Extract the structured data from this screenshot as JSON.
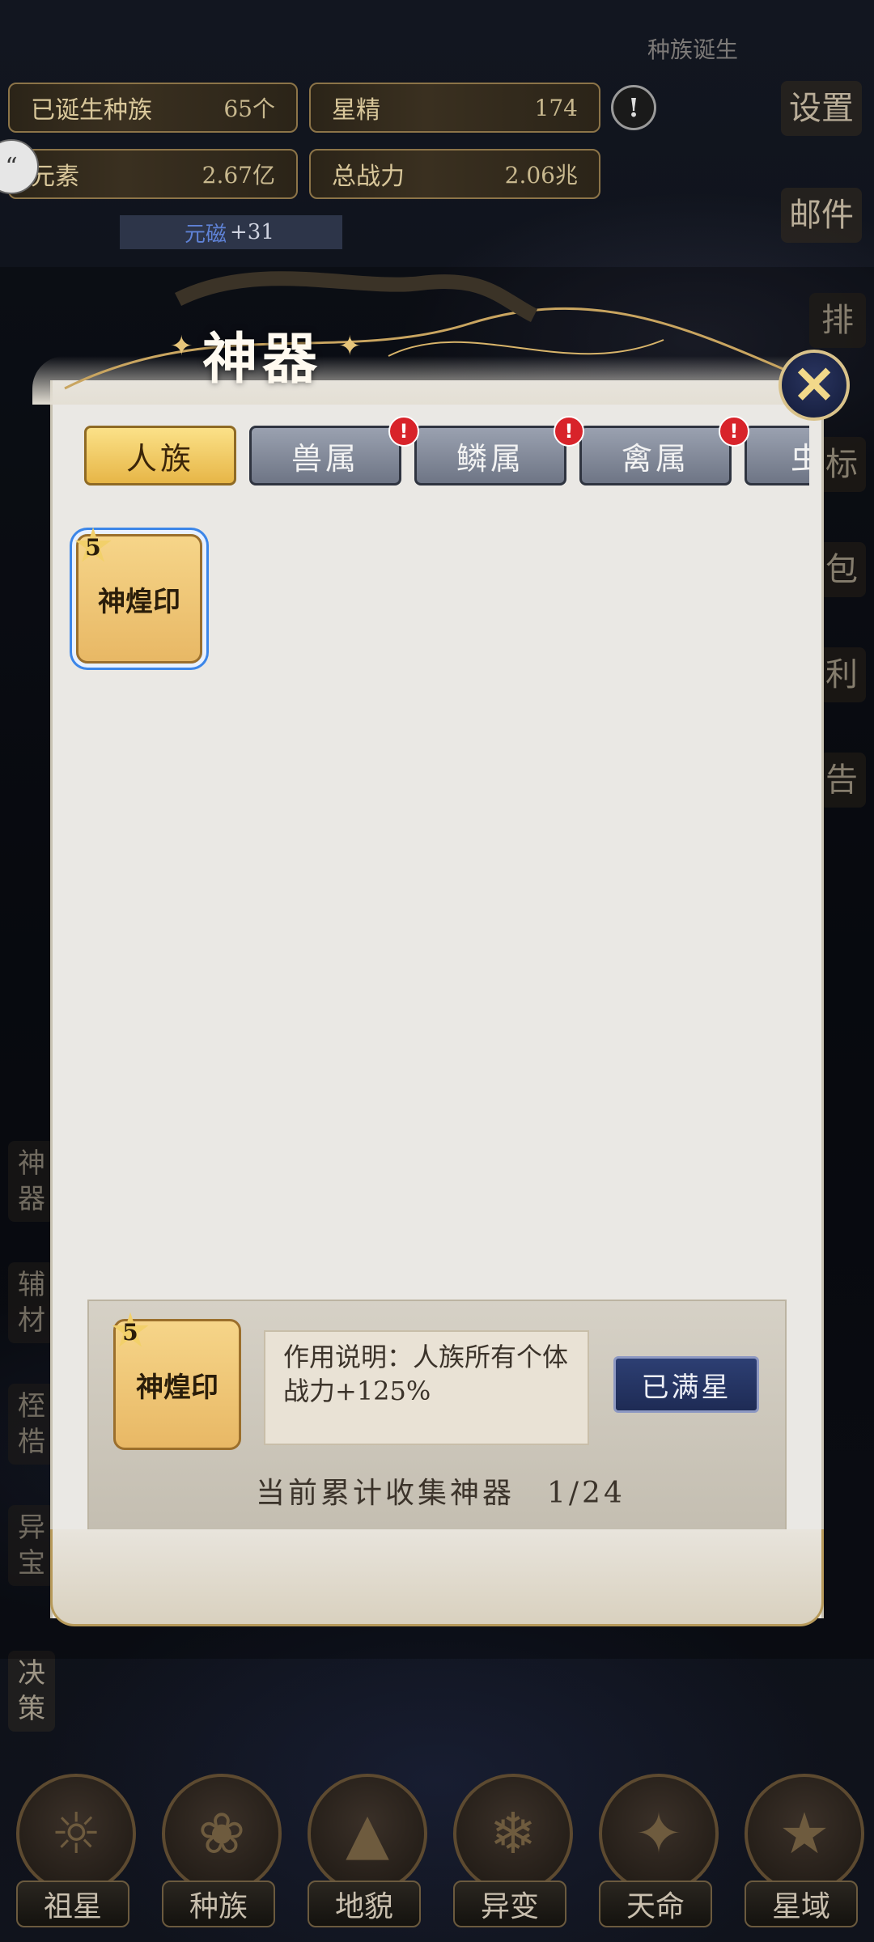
{
  "top_bar": {
    "corner_label": "种族诞生",
    "stats": [
      {
        "label": "已诞生种族",
        "value": "65个"
      },
      {
        "label": "星精",
        "value": "174"
      },
      {
        "label": "元素",
        "value": "2.67亿"
      },
      {
        "label": "总战力",
        "value": "2.06兆"
      }
    ],
    "alert_symbol": "!",
    "bonus_prefix": "元磁",
    "bonus_value": "+31"
  },
  "right_menu": [
    "设置",
    "邮件",
    "排",
    "标",
    "包",
    "利",
    "告"
  ],
  "left_menu": [
    "神器",
    "辅材",
    "桎梏",
    "异宝",
    "决策"
  ],
  "modal": {
    "title": "神器",
    "close_icon": "close-icon",
    "tabs": [
      {
        "label": "人族",
        "active": true,
        "alert": false
      },
      {
        "label": "兽属",
        "active": false,
        "alert": true
      },
      {
        "label": "鳞属",
        "active": false,
        "alert": true
      },
      {
        "label": "禽属",
        "active": false,
        "alert": true
      },
      {
        "label": "虫",
        "active": false,
        "alert": false
      }
    ],
    "alert_mark": "!",
    "artifacts": [
      {
        "name": "神煌印",
        "stars": "5"
      }
    ],
    "selected": {
      "name": "神煌印",
      "stars": "5",
      "description": "作用说明：人族所有个体战力+125%",
      "button": "已满星"
    },
    "collection": "当前累计收集神器　1/24"
  },
  "bottom_nav": [
    "祖星",
    "种族",
    "地貌",
    "异变",
    "天命",
    "星域"
  ],
  "colors": {
    "tab_active": "#f2c961",
    "tab_inactive": "#858c9c",
    "alert_red": "#d8232a",
    "panel_bg": "#eae8e4",
    "button_navy": "#243463"
  }
}
